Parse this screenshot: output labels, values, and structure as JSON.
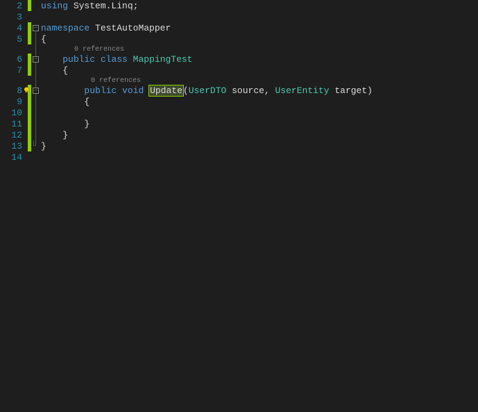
{
  "lines": {
    "l2": "2",
    "l3": "3",
    "l4": "4",
    "l5": "5",
    "l6": "6",
    "l7": "7",
    "l8": "8",
    "l9": "9",
    "l10": "10",
    "l11": "11",
    "l12": "12",
    "l13": "13",
    "l14": "14"
  },
  "code": {
    "using": "using",
    "systemLinq": "System.Linq;",
    "namespace": "namespace",
    "nsName": "TestAutoMapper",
    "openBrace": "{",
    "closeBrace": "}",
    "refs": "0 references",
    "public": "public",
    "class": "class",
    "className": "MappingTest",
    "void": "void",
    "methodName": "Update",
    "paren1": "(",
    "type1": "UserDTO",
    "param1": " source, ",
    "type2": "UserEntity",
    "param2": " target",
    "paren2": ")"
  },
  "indent": {
    "i1": "    ",
    "i2": "        ",
    "i3": "            ",
    "refIndent1": "        ",
    "refIndent2": "            "
  }
}
